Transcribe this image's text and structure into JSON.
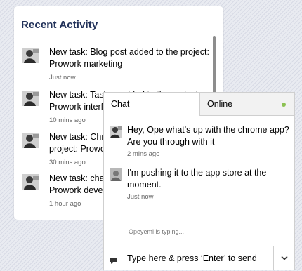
{
  "activity": {
    "title": "Recent Activity",
    "items": [
      {
        "text": "New task: Blog post added to the project: Prowork marketing",
        "time": "Just now"
      },
      {
        "text": "New task: Task ... added to the project: Prowork interface",
        "time": "10 mins ago"
      },
      {
        "text": "New task: Chrome ... added to the project: Prowork ...",
        "time": "30 mins ago"
      },
      {
        "text": "New task: chat ... added to the project: Prowork development",
        "time": "1 hour ago"
      }
    ]
  },
  "chat": {
    "tabs": {
      "chat": "Chat",
      "online": "Online"
    },
    "messages": [
      {
        "text": "Hey, Ope what's up with the chrome app? Are you through with it",
        "time": "2 mins ago"
      },
      {
        "text": "I'm pushing it to the app store at the moment.",
        "time": "Just now"
      }
    ],
    "typing": "Opeyemi is typing...",
    "composer_placeholder": "Type here & press ‘Enter’ to send"
  },
  "colors": {
    "title": "#22325a",
    "online_dot": "#8cc152"
  },
  "icons": {
    "message": "chat-bubble-icon",
    "dropdown": "chevron-down-icon",
    "avatar": "user-avatar"
  }
}
